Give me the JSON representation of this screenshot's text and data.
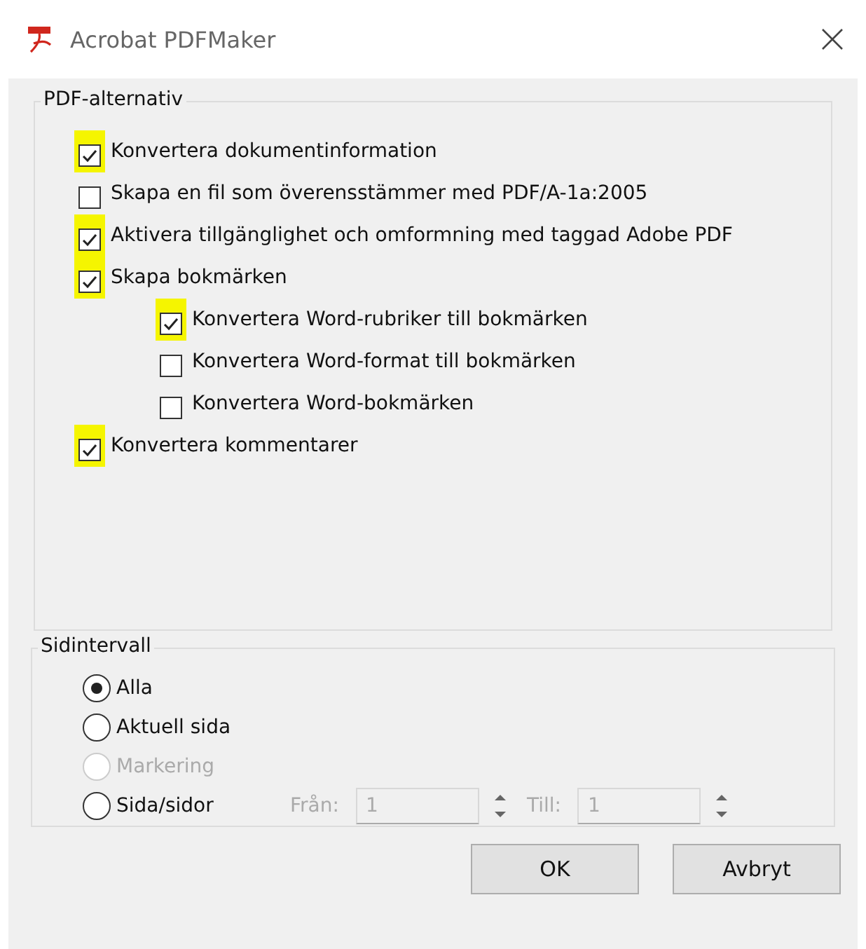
{
  "window": {
    "title": "Acrobat PDFMaker"
  },
  "pdf_options": {
    "title": "PDF-alternativ",
    "items": [
      {
        "label": "Konvertera dokumentinformation",
        "checked": true,
        "highlighted": true
      },
      {
        "label": "Skapa en fil som överensstämmer med PDF/A-1a:2005",
        "checked": false,
        "highlighted": false
      },
      {
        "label": "Aktivera tillgänglighet och omformning med taggad Adobe PDF",
        "checked": true,
        "highlighted": true
      },
      {
        "label": "Skapa bokmärken",
        "checked": true,
        "highlighted": true,
        "children": [
          {
            "label": "Konvertera Word-rubriker till bokmärken",
            "checked": true,
            "highlighted": true
          },
          {
            "label": "Konvertera Word-format till bokmärken",
            "checked": false,
            "highlighted": false
          },
          {
            "label": "Konvertera Word-bokmärken",
            "checked": false,
            "highlighted": false
          }
        ]
      },
      {
        "label": "Konvertera kommentarer",
        "checked": true,
        "highlighted": true
      }
    ]
  },
  "page_range": {
    "title": "Sidintervall",
    "options": [
      {
        "label": "Alla",
        "selected": true,
        "disabled": false
      },
      {
        "label": "Aktuell sida",
        "selected": false,
        "disabled": false
      },
      {
        "label": "Markering",
        "selected": false,
        "disabled": true
      },
      {
        "label": "Sida/sidor",
        "selected": false,
        "disabled": false
      }
    ],
    "from": {
      "label": "Från:",
      "value": "1",
      "disabled": true
    },
    "to": {
      "label": "Till:",
      "value": "1",
      "disabled": true
    }
  },
  "buttons": [
    "OK",
    "Avbryt"
  ]
}
